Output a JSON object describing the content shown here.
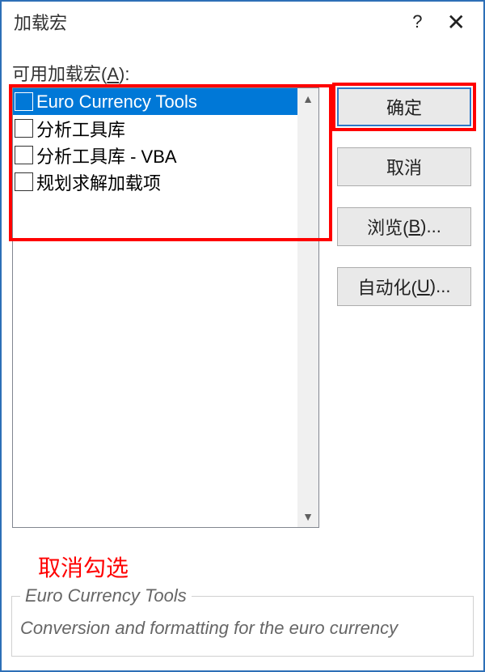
{
  "titlebar": {
    "title": "加载宏",
    "help": "?",
    "close": "✕"
  },
  "label_text": "可用加载宏(",
  "label_accel": "A",
  "label_suffix": "):",
  "list": {
    "items": [
      {
        "label": "Euro Currency Tools",
        "checked": false,
        "selected": true
      },
      {
        "label": "分析工具库",
        "checked": false,
        "selected": false
      },
      {
        "label": "分析工具库 - VBA",
        "checked": false,
        "selected": false
      },
      {
        "label": "规划求解加载项",
        "checked": false,
        "selected": false
      }
    ],
    "scroll_up": "▲",
    "scroll_down": "▼"
  },
  "buttons": {
    "ok": "确定",
    "cancel": "取消",
    "browse_pre": "浏览(",
    "browse_accel": "B",
    "browse_suf": ")...",
    "auto_pre": "自动化(",
    "auto_accel": "U",
    "auto_suf": ")..."
  },
  "annotation": "取消勾选",
  "group": {
    "title": "Euro Currency Tools",
    "desc": "Conversion and formatting for the euro currency"
  }
}
